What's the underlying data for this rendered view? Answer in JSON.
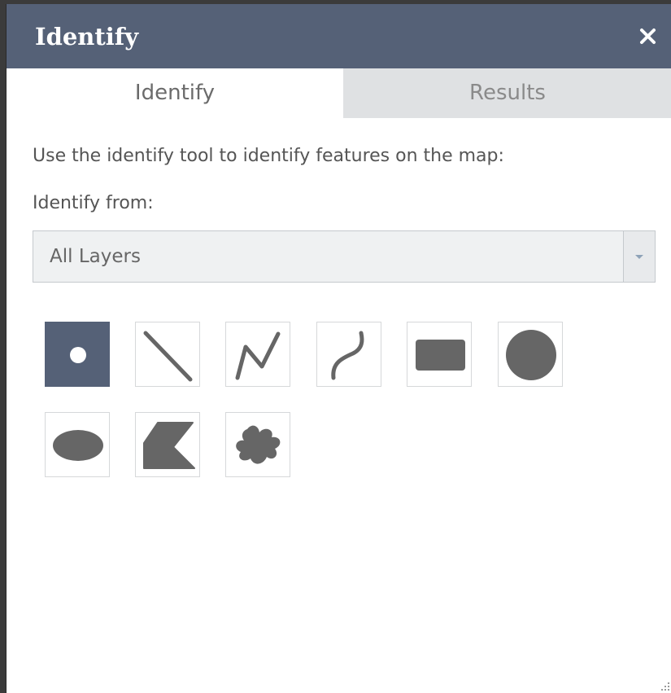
{
  "window": {
    "title": "Identify",
    "close_symbol": "×"
  },
  "tabs": [
    {
      "label": "Identify",
      "active": true
    },
    {
      "label": "Results",
      "active": false
    }
  ],
  "instructions": "Use the identify tool to identify features on the map:",
  "identify_from": {
    "label": "Identify from:",
    "selected": "All Layers"
  },
  "tools": [
    {
      "name": "point",
      "icon": "point-icon",
      "active": true
    },
    {
      "name": "line",
      "icon": "line-icon",
      "active": false
    },
    {
      "name": "polyline",
      "icon": "polyline-icon",
      "active": false
    },
    {
      "name": "freehand-polyline",
      "icon": "freehand-polyline-icon",
      "active": false
    },
    {
      "name": "extent",
      "icon": "rectangle-icon",
      "active": false
    },
    {
      "name": "circle",
      "icon": "circle-icon",
      "active": false
    },
    {
      "name": "ellipse",
      "icon": "ellipse-icon",
      "active": false
    },
    {
      "name": "polygon",
      "icon": "polygon-icon",
      "active": false
    },
    {
      "name": "freehand-polygon",
      "icon": "freehand-polygon-icon",
      "active": false
    }
  ],
  "colors": {
    "accent": "#556177",
    "icon": "#666666",
    "inactive_tab": "#dfe1e3"
  }
}
